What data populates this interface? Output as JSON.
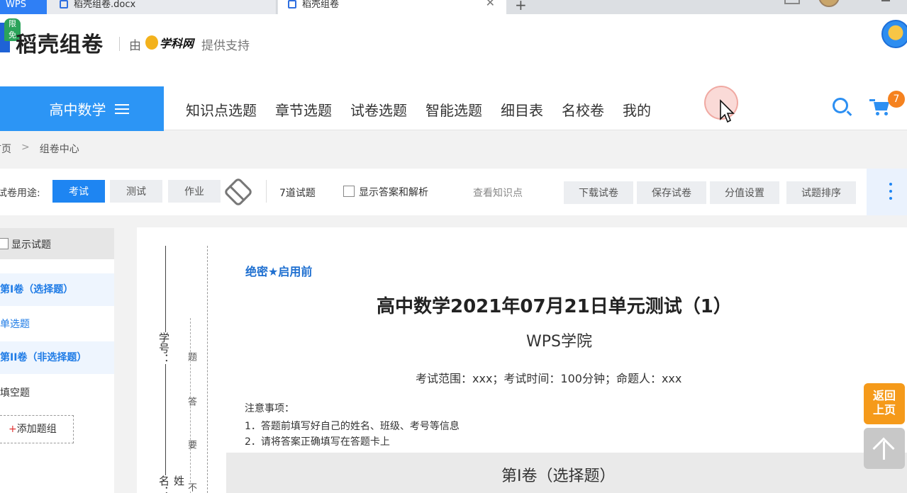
{
  "browser": {
    "tabs": [
      {
        "label": "WPS"
      },
      {
        "label": "稻壳组卷.docx"
      },
      {
        "label": "稻壳组卷"
      }
    ]
  },
  "header": {
    "badge": "限免",
    "brand": "稻壳组卷",
    "by": "由",
    "partner": "学科网",
    "support": "提供支持"
  },
  "nav": {
    "subject": "高中数学",
    "items": [
      "知识点选题",
      "章节选题",
      "试卷选题",
      "智能选题",
      "细目表",
      "名校卷",
      "我的"
    ],
    "cart_count": "7",
    "accent": "#2c95f5"
  },
  "breadcrumb": {
    "home": "首页",
    "sep": ">",
    "current": "组卷中心"
  },
  "toolbar": {
    "purpose_label": "试卷用途:",
    "purposes": [
      "考试",
      "测试",
      "作业"
    ],
    "active_purpose": "考试",
    "question_count": "7道试题",
    "show_answers": "显示答案和解析",
    "view_kp": "查看知识点",
    "actions": [
      "下载试卷",
      "保存试卷",
      "分值设置",
      "试题排序"
    ]
  },
  "left_panel": {
    "show_questions": "显示试题",
    "sections": [
      {
        "title": "第I卷（选择题）",
        "items": [
          "单选题"
        ]
      },
      {
        "title": "第II卷（非选择题）",
        "items": [
          "填空题"
        ]
      }
    ],
    "add_group": "添加题组"
  },
  "document": {
    "binding": {
      "student_id": "学号：",
      "name": "姓名：",
      "d1": "题",
      "d2": "答",
      "d3": "要",
      "d4": "不"
    },
    "secret": "绝密★启用前",
    "title": "高中数学2021年07月21日单元测试（1）",
    "subtitle": "WPS学院",
    "meta": "考试范围：xxx；考试时间：100分钟；命题人：xxx",
    "notes_title": "注意事项：",
    "notes": [
      "1．答题前填写好自己的姓名、班级、考号等信息",
      "2．请将答案正确填写在答题卡上"
    ],
    "section_title": "第I卷（选择题）"
  },
  "floating": {
    "back": "返回上页"
  }
}
